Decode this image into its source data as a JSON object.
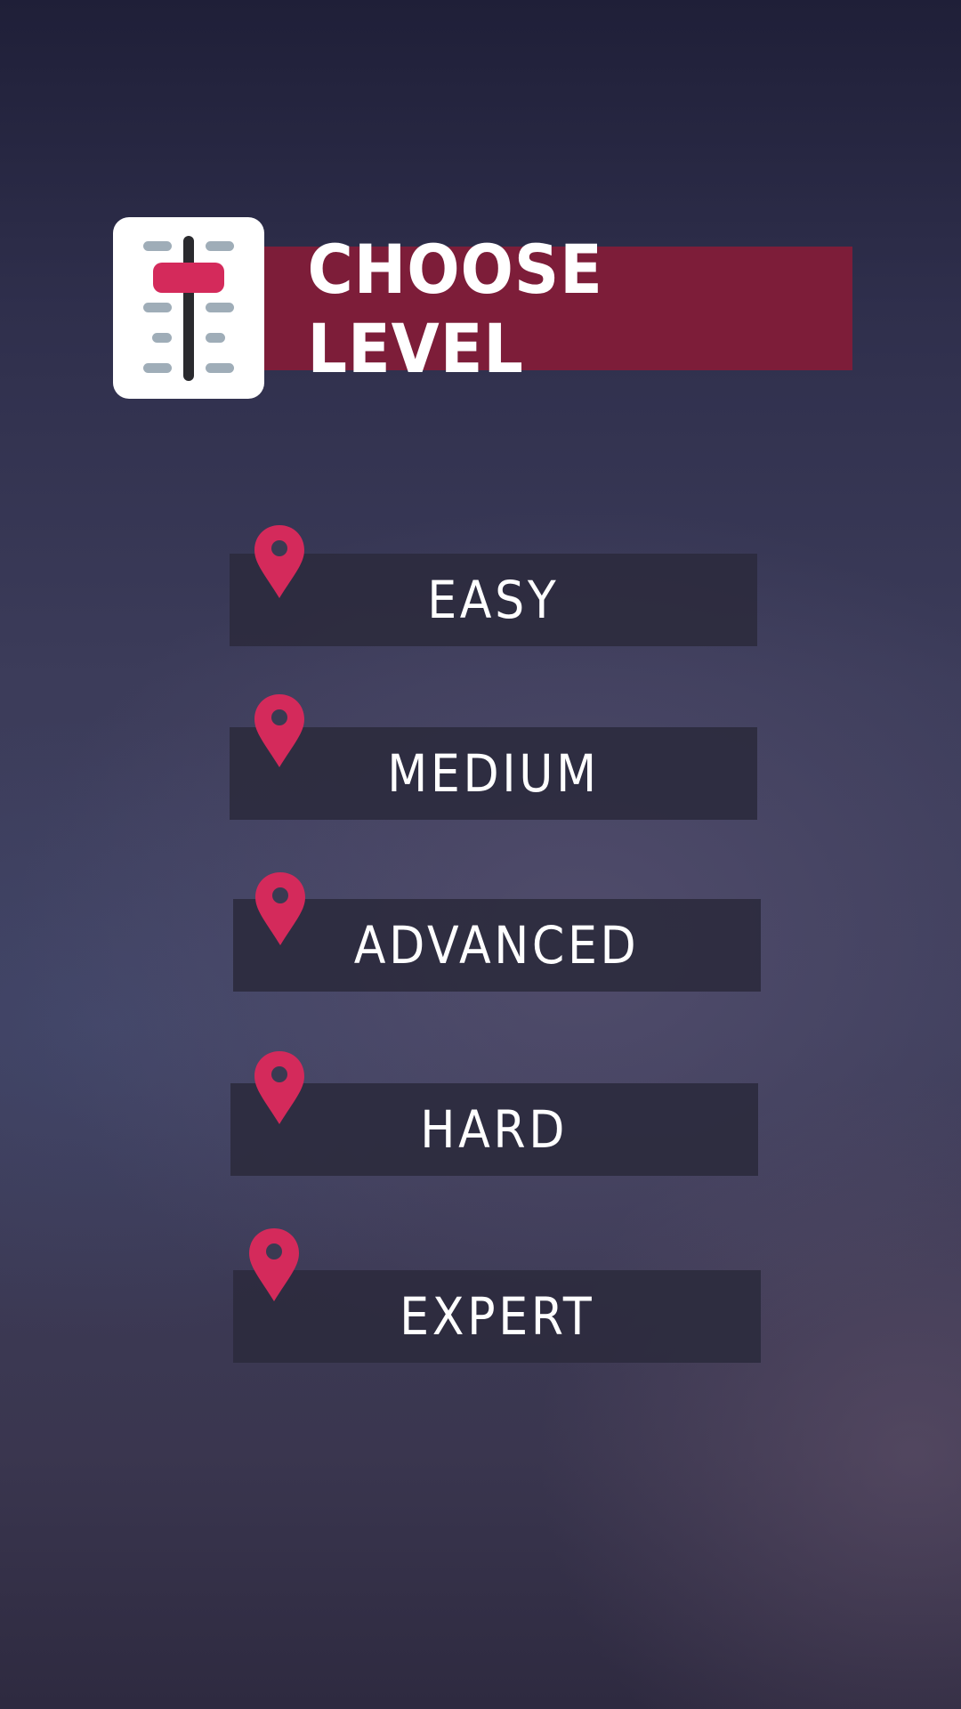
{
  "header": {
    "title": "CHOOSE LEVEL",
    "icon": "level-slider-icon",
    "banner_color": "#7d1d39"
  },
  "levels": [
    {
      "label": "EASY",
      "icon": "map-pin-icon"
    },
    {
      "label": "MEDIUM",
      "icon": "map-pin-icon"
    },
    {
      "label": "ADVANCED",
      "icon": "map-pin-icon"
    },
    {
      "label": "HARD",
      "icon": "map-pin-icon"
    },
    {
      "label": "EXPERT",
      "icon": "map-pin-icon"
    }
  ],
  "colors": {
    "accent": "#d42a5b",
    "button_bg": "#2c2b3e",
    "text": "#ffffff"
  }
}
